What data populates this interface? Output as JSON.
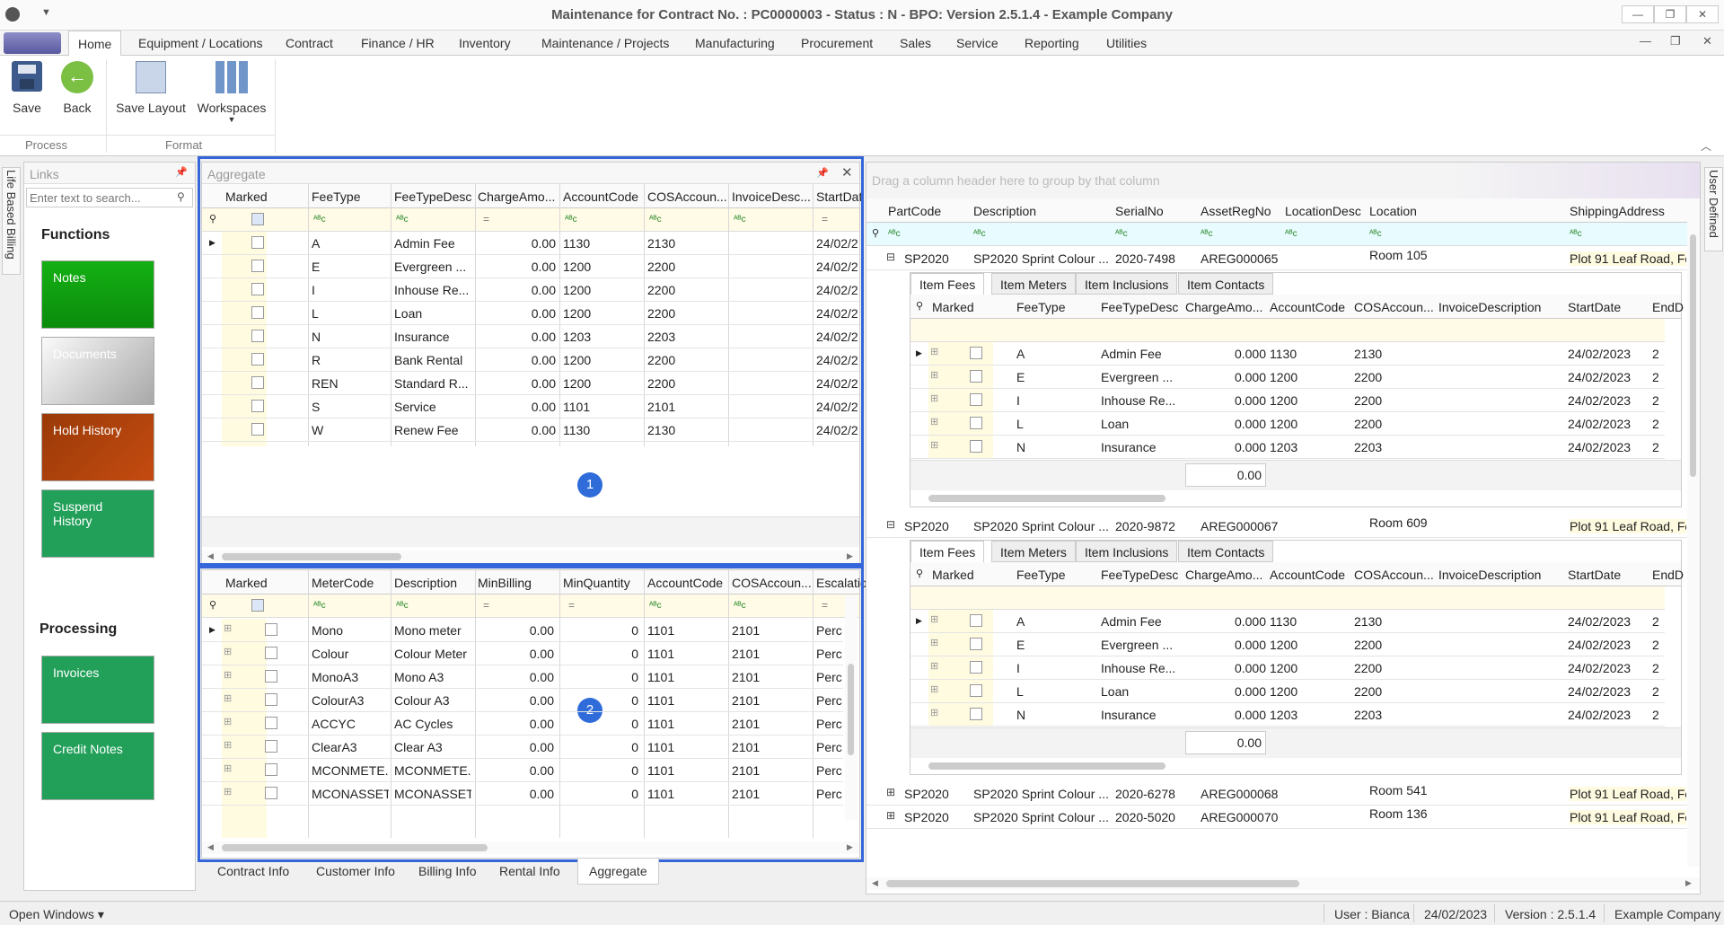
{
  "window": {
    "title": "Maintenance for Contract No. : PC0000003 - Status : N - BPO: Version 2.5.1.4 - Example Company",
    "controls": [
      "—",
      "❐",
      "✕"
    ]
  },
  "menu": {
    "tabs": [
      "Home",
      "Equipment / Locations",
      "Contract",
      "Finance / HR",
      "Inventory",
      "Maintenance / Projects",
      "Manufacturing",
      "Procurement",
      "Sales",
      "Service",
      "Reporting",
      "Utilities"
    ]
  },
  "ribbon": {
    "save": "Save",
    "back": "Back",
    "save_layout": "Save Layout",
    "workspaces": "Workspaces",
    "group_process": "Process",
    "group_format": "Format"
  },
  "side_strips": {
    "left": "Life Based Billing",
    "right": "User Defined"
  },
  "links": {
    "title": "Links",
    "search_placeholder": "Enter text to search...",
    "functions_heading": "Functions",
    "processing_heading": "Processing",
    "functions": [
      {
        "label": "Notes",
        "color": "#13a613"
      },
      {
        "label": "Documents",
        "color": "#c8c8c8"
      },
      {
        "label": "Hold History",
        "color": "#b8430c"
      },
      {
        "label": "Suspend History",
        "color": "#22a05a"
      }
    ],
    "processing": [
      {
        "label": "Invoices",
        "color": "#22a05a"
      },
      {
        "label": "Credit Notes",
        "color": "#22a05a"
      }
    ]
  },
  "aggregate": {
    "title": "Aggregate",
    "columns": [
      "Marked",
      "FeeType",
      "FeeTypeDesc",
      "ChargeAmo...",
      "AccountCode",
      "COSAccoun...",
      "InvoiceDesc...",
      "StartDat"
    ],
    "rows": [
      [
        "A",
        "Admin Fee",
        "0.00",
        "1130",
        "2130",
        "",
        "24/02/2"
      ],
      [
        "E",
        "Evergreen ...",
        "0.00",
        "1200",
        "2200",
        "",
        "24/02/2"
      ],
      [
        "I",
        "Inhouse Re...",
        "0.00",
        "1200",
        "2200",
        "",
        "24/02/2"
      ],
      [
        "L",
        "Loan",
        "0.00",
        "1200",
        "2200",
        "",
        "24/02/2"
      ],
      [
        "N",
        "Insurance",
        "0.00",
        "1203",
        "2203",
        "",
        "24/02/2"
      ],
      [
        "R",
        "Bank Rental",
        "0.00",
        "1200",
        "2200",
        "",
        "24/02/2"
      ],
      [
        "REN",
        "Standard R...",
        "0.00",
        "1200",
        "2200",
        "",
        "24/02/2"
      ],
      [
        "S",
        "Service",
        "0.00",
        "1101",
        "2101",
        "",
        "24/02/2"
      ],
      [
        "W",
        "Renew Fee",
        "0.00",
        "1130",
        "2130",
        "",
        "24/02/2"
      ]
    ],
    "badge": "1"
  },
  "meters": {
    "columns": [
      "Marked",
      "MeterCode",
      "Description",
      "MinBilling",
      "MinQuantity",
      "AccountCode",
      "COSAccoun...",
      "Escalatio"
    ],
    "rows": [
      [
        "Mono",
        "Mono meter",
        "0.00",
        "0",
        "1101",
        "2101",
        "Perc"
      ],
      [
        "Colour",
        "Colour Meter",
        "0.00",
        "0",
        "1101",
        "2101",
        "Perc"
      ],
      [
        "MonoA3",
        "Mono A3",
        "0.00",
        "0",
        "1101",
        "2101",
        "Perc"
      ],
      [
        "ColourA3",
        "Colour A3",
        "0.00",
        "0",
        "1101",
        "2101",
        "Perc"
      ],
      [
        "ACCYC",
        "AC Cycles",
        "0.00",
        "0",
        "1101",
        "2101",
        "Perc"
      ],
      [
        "ClearA3",
        "Clear A3",
        "0.00",
        "0",
        "1101",
        "2101",
        "Perc"
      ],
      [
        "MCONMETE...",
        "MCONMETE...",
        "0.00",
        "0",
        "1101",
        "2101",
        "Perc"
      ],
      [
        "MCONASSETS",
        "MCONASSETS",
        "0.00",
        "0",
        "1101",
        "2101",
        "Perc"
      ]
    ],
    "badge": "2"
  },
  "bottom_tabs": [
    "Contract Info",
    "Customer Info",
    "Billing Info",
    "Rental Info",
    "Aggregate"
  ],
  "equipment": {
    "group_hint": "Drag a column header here to group by that column",
    "columns": [
      "PartCode",
      "Description",
      "SerialNo",
      "AssetRegNo",
      "LocationDesc",
      "Location",
      "ShippingAddress"
    ],
    "detail_tabs": [
      "Item Fees",
      "Item Meters",
      "Item Inclusions",
      "Item Contacts"
    ],
    "detail_columns": [
      "Marked",
      "FeeType",
      "FeeTypeDesc",
      "ChargeAmo...",
      "AccountCode",
      "COSAccoun...",
      "InvoiceDescription",
      "StartDate",
      "EndD"
    ],
    "detail_rows": [
      [
        "A",
        "Admin Fee",
        "0.000",
        "1130",
        "2130",
        "",
        "24/02/2023",
        "2"
      ],
      [
        "E",
        "Evergreen ...",
        "0.000",
        "1200",
        "2200",
        "",
        "24/02/2023",
        "2"
      ],
      [
        "I",
        "Inhouse Re...",
        "0.000",
        "1200",
        "2200",
        "",
        "24/02/2023",
        "2"
      ],
      [
        "L",
        "Loan",
        "0.000",
        "1200",
        "2200",
        "",
        "24/02/2023",
        "2"
      ],
      [
        "N",
        "Insurance",
        "0.000",
        "1203",
        "2203",
        "",
        "24/02/2023",
        "2"
      ]
    ],
    "detail_total": "0.00",
    "rows": [
      [
        "SP2020",
        "SP2020 Sprint Colour ...",
        "2020-7498",
        "AREG000065",
        "",
        "Room 105",
        "Plot 91 Leaf Road, Fc"
      ],
      [
        "SP2020",
        "SP2020 Sprint Colour ...",
        "2020-9872",
        "AREG000067",
        "",
        "Room 609",
        "Plot 91 Leaf Road, Fc"
      ],
      [
        "SP2020",
        "SP2020 Sprint Colour ...",
        "2020-6278",
        "AREG000068",
        "",
        "Room 541",
        "Plot 91 Leaf Road, Fc"
      ],
      [
        "SP2020",
        "SP2020 Sprint Colour ...",
        "2020-5020",
        "AREG000070",
        "",
        "Room 136",
        "Plot 91 Leaf Road, Fc"
      ]
    ]
  },
  "status": {
    "open_windows": "Open Windows ▾",
    "user": "User : Bianca",
    "date": "24/02/2023",
    "version": "Version : 2.5.1.4",
    "company": "Example Company"
  }
}
